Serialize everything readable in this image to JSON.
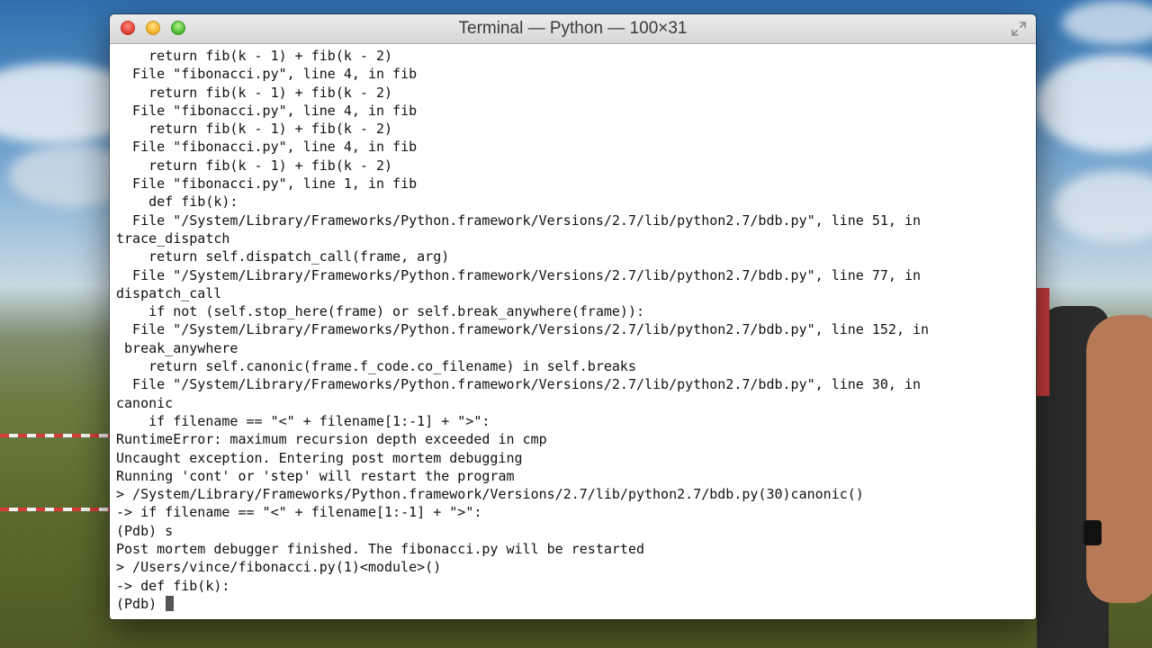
{
  "window": {
    "title": "Terminal — Python — 100×31"
  },
  "terminal": {
    "lines": [
      "    return fib(k - 1) + fib(k - 2)",
      "  File \"fibonacci.py\", line 4, in fib",
      "    return fib(k - 1) + fib(k - 2)",
      "  File \"fibonacci.py\", line 4, in fib",
      "    return fib(k - 1) + fib(k - 2)",
      "  File \"fibonacci.py\", line 4, in fib",
      "    return fib(k - 1) + fib(k - 2)",
      "  File \"fibonacci.py\", line 1, in fib",
      "    def fib(k):",
      "  File \"/System/Library/Frameworks/Python.framework/Versions/2.7/lib/python2.7/bdb.py\", line 51, in",
      "trace_dispatch",
      "    return self.dispatch_call(frame, arg)",
      "  File \"/System/Library/Frameworks/Python.framework/Versions/2.7/lib/python2.7/bdb.py\", line 77, in",
      "dispatch_call",
      "    if not (self.stop_here(frame) or self.break_anywhere(frame)):",
      "  File \"/System/Library/Frameworks/Python.framework/Versions/2.7/lib/python2.7/bdb.py\", line 152, in",
      " break_anywhere",
      "    return self.canonic(frame.f_code.co_filename) in self.breaks",
      "  File \"/System/Library/Frameworks/Python.framework/Versions/2.7/lib/python2.7/bdb.py\", line 30, in",
      "canonic",
      "    if filename == \"<\" + filename[1:-1] + \">\":",
      "RuntimeError: maximum recursion depth exceeded in cmp",
      "Uncaught exception. Entering post mortem debugging",
      "Running 'cont' or 'step' will restart the program",
      "> /System/Library/Frameworks/Python.framework/Versions/2.7/lib/python2.7/bdb.py(30)canonic()",
      "-> if filename == \"<\" + filename[1:-1] + \">\":",
      "(Pdb) s",
      "Post mortem debugger finished. The fibonacci.py will be restarted",
      "> /Users/vince/fibonacci.py(1)<module>()",
      "-> def fib(k):"
    ],
    "prompt": "(Pdb) "
  }
}
